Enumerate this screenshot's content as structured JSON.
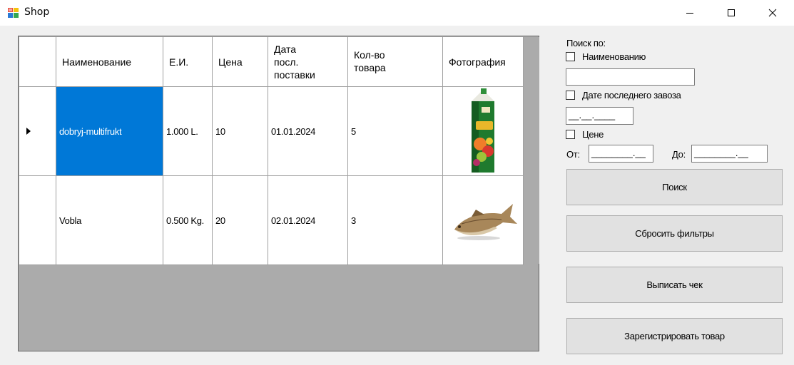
{
  "window": {
    "title": "Shop",
    "minimize_glyph": "—",
    "maximize_glyph": "☐",
    "close_glyph": "✕"
  },
  "grid": {
    "columns": [
      "Наименование",
      "Е.И.",
      "Цена",
      "Дата\nпосл.\nпоставки",
      "Кол-во\nтовара",
      "Фотография"
    ],
    "rows": [
      {
        "name": "dobryj-multifrukt",
        "unit": "1.000 L.",
        "price": "10",
        "date": "01.01.2024",
        "qty": "5",
        "photo": "juice-carton-image",
        "selected": true
      },
      {
        "name": "Vobla",
        "unit": "0.500 Kg.",
        "price": "20",
        "date": "02.01.2024",
        "qty": "3",
        "photo": "dried-fish-image",
        "selected": false
      }
    ]
  },
  "search": {
    "heading": "Поиск по:",
    "by_name_label": "Наименованию",
    "name_value": "",
    "by_date_label": "Дате последнего завоза",
    "date_mask": "__.__.____",
    "by_price_label": "Цене",
    "from_label": "От:",
    "to_label": "До:",
    "price_mask": "________.__"
  },
  "buttons": {
    "search": "Поиск",
    "reset": "Сбросить фильтры",
    "receipt": "Выписать чек",
    "register": "Зарегистрировать товар"
  },
  "colors": {
    "selection": "#0078d7",
    "grid_background": "#ababab",
    "button_face": "#e1e1e1"
  }
}
